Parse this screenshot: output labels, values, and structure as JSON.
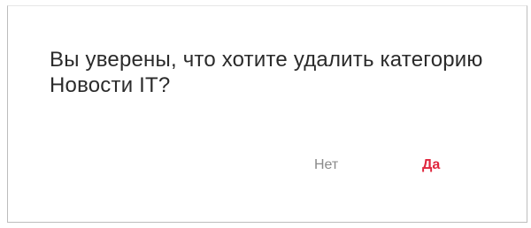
{
  "dialog": {
    "message": "Вы уверены, что хотите удалить категорию Новости IT?",
    "no_label": "Нет",
    "yes_label": "Да"
  },
  "colors": {
    "text": "#2b2b2b",
    "no_button": "#8a8a8a",
    "yes_button": "#e0273e"
  }
}
